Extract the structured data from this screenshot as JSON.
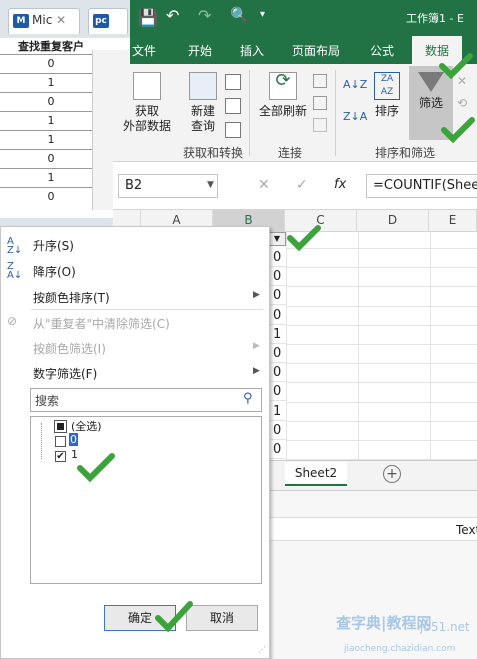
{
  "bg_tabs": [
    {
      "label": "Mic"
    },
    {
      "label": ""
    }
  ],
  "bg_doc": {
    "title": "查找重复客户",
    "values": [
      "0",
      "1",
      "0",
      "1",
      "1",
      "0",
      "1",
      "0"
    ]
  },
  "titlebar": {
    "title": "工作簿1 - E"
  },
  "ribbon_tabs": [
    "文件",
    "开始",
    "插入",
    "页面布局",
    "公式",
    "数据"
  ],
  "ribbon": {
    "get_external": "获取\n外部数据",
    "new_query": "新建\n查询",
    "group1": "获取和转换",
    "refresh_all": "全部刷新",
    "group2": "连接",
    "sort": "排序",
    "filter": "筛选",
    "group3": "排序和筛选"
  },
  "formula_bar": {
    "name_box": "B2",
    "fx": "fx",
    "formula": "=COUNTIF(Shee"
  },
  "columns": [
    "A",
    "B",
    "C",
    "D",
    "E"
  ],
  "column_b_values": [
    "0",
    "0",
    "0",
    "0",
    "1",
    "0",
    "0",
    "0",
    "1",
    "0",
    "0"
  ],
  "sheet_tab": "Sheet2",
  "lower_window_text": "Text",
  "menu": {
    "sort_asc": "升序(S)",
    "sort_desc": "降序(O)",
    "sort_color": "按颜色排序(T)",
    "clear_filter": "从\"重复者\"中清除筛选(C)",
    "filter_color": "按颜色筛选(I)",
    "number_filter": "数字筛选(F)",
    "search_placeholder": "搜索",
    "list": [
      {
        "label": "(全选)",
        "state": "partial"
      },
      {
        "label": "0",
        "state": "unchecked"
      },
      {
        "label": "1",
        "state": "checked"
      }
    ],
    "ok": "确定",
    "cancel": "取消"
  },
  "watermark": {
    "a": "查字典",
    "b": "教程网",
    "c": "jiaocheng.chazidian.com",
    "d": "jb51.net"
  },
  "colors": {
    "excel_green": "#217346",
    "check_green": "#3aa33a"
  }
}
